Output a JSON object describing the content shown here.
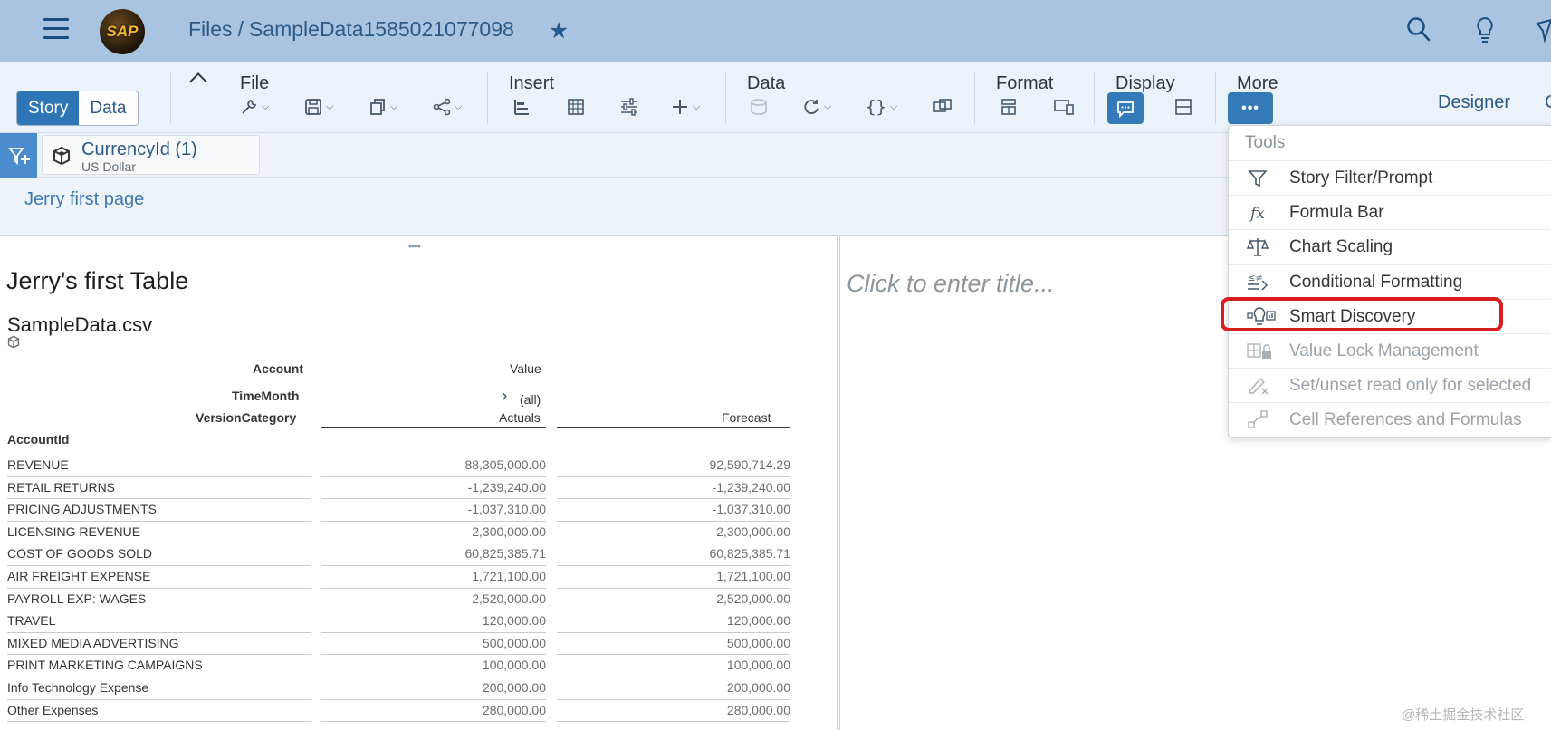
{
  "shell": {
    "logo_text": "SAP",
    "breadcrumb_root": "Files",
    "breadcrumb_sep": "/",
    "breadcrumb_current": "SampleData1585021077098"
  },
  "toolbar": {
    "mode_story": "Story",
    "mode_data": "Data",
    "groups": {
      "file": "File",
      "insert": "Insert",
      "data": "Data",
      "format": "Format",
      "display": "Display",
      "more": "More"
    },
    "designer": "Designer",
    "designer_cut": "C"
  },
  "filterbar": {
    "token_title": "CurrencyId (1)",
    "token_value": "US Dollar"
  },
  "pages": {
    "active_tab": "Jerry first page"
  },
  "table_widget": {
    "title": "Jerry's first Table",
    "source": "SampleData.csv",
    "headers": {
      "account": "Account",
      "value": "Value",
      "timemonth": "TimeMonth",
      "all": "(all)",
      "versioncategory": "VersionCategory",
      "actuals": "Actuals",
      "forecast": "Forecast",
      "accountid": "AccountId"
    },
    "rows": [
      {
        "account": "REVENUE",
        "actuals": "88,305,000.00",
        "forecast": "92,590,714.29"
      },
      {
        "account": "RETAIL RETURNS",
        "actuals": "-1,239,240.00",
        "forecast": "-1,239,240.00"
      },
      {
        "account": "PRICING ADJUSTMENTS",
        "actuals": "-1,037,310.00",
        "forecast": "-1,037,310.00"
      },
      {
        "account": "LICENSING REVENUE",
        "actuals": "2,300,000.00",
        "forecast": "2,300,000.00"
      },
      {
        "account": "COST OF GOODS SOLD",
        "actuals": "60,825,385.71",
        "forecast": "60,825,385.71"
      },
      {
        "account": "AIR FREIGHT EXPENSE",
        "actuals": "1,721,100.00",
        "forecast": "1,721,100.00"
      },
      {
        "account": "PAYROLL EXP: WAGES",
        "actuals": "2,520,000.00",
        "forecast": "2,520,000.00"
      },
      {
        "account": "TRAVEL",
        "actuals": "120,000.00",
        "forecast": "120,000.00"
      },
      {
        "account": "MIXED MEDIA ADVERTISING",
        "actuals": "500,000.00",
        "forecast": "500,000.00"
      },
      {
        "account": "PRINT MARKETING CAMPAIGNS",
        "actuals": "100,000.00",
        "forecast": "100,000.00"
      },
      {
        "account": "Info Technology Expense",
        "actuals": "200,000.00",
        "forecast": "200,000.00"
      },
      {
        "account": "Other Expenses",
        "actuals": "280,000.00",
        "forecast": "280,000.00"
      }
    ]
  },
  "second_widget": {
    "title_placeholder": "Click to enter title..."
  },
  "more_menu": {
    "section": "Tools",
    "items": [
      {
        "label": "Story Filter/Prompt",
        "icon": "funnel-icon",
        "enabled": true
      },
      {
        "label": "Formula Bar",
        "icon": "fx-icon",
        "enabled": true
      },
      {
        "label": "Chart Scaling",
        "icon": "scale-balance-icon",
        "enabled": true
      },
      {
        "label": "Conditional Formatting",
        "icon": "conditional-format-icon",
        "enabled": true
      },
      {
        "label": "Smart Discovery",
        "icon": "lightbulb-chart-icon",
        "enabled": true,
        "highlighted": true
      },
      {
        "label": "Value Lock Management",
        "icon": "value-lock-icon",
        "enabled": false
      },
      {
        "label": "Set/unset read only for selected",
        "icon": "pencil-x-icon",
        "enabled": false
      },
      {
        "label": "Cell References and Formulas",
        "icon": "cell-reference-icon",
        "enabled": false
      }
    ]
  },
  "watermark": "@稀土掘金技术社区",
  "colors": {
    "shell_bg": "#a9c4e0",
    "toolbar_bg": "#ecf2f9",
    "accent": "#357ab8",
    "highlight_red": "#d71e1e"
  }
}
